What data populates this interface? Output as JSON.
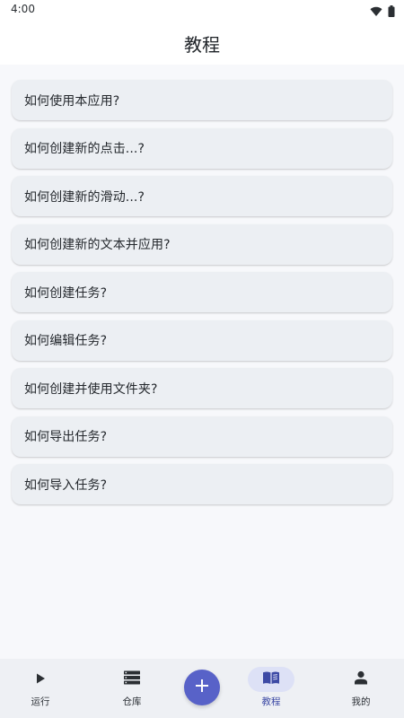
{
  "status_bar": {
    "time": "4:00",
    "icons": [
      "wifi-icon",
      "battery-icon"
    ]
  },
  "header": {
    "title": "教程"
  },
  "tutorials": [
    {
      "label": "如何使用本应用?"
    },
    {
      "label": "如何创建新的点击...?"
    },
    {
      "label": "如何创建新的滑动...?"
    },
    {
      "label": "如何创建新的文本并应用?"
    },
    {
      "label": "如何创建任务?"
    },
    {
      "label": "如何编辑任务?"
    },
    {
      "label": "如何创建并使用文件夹?"
    },
    {
      "label": "如何导出任务?"
    },
    {
      "label": "如何导入任务?"
    }
  ],
  "bottom_nav": {
    "items": [
      {
        "label": "运行",
        "icon": "play-icon"
      },
      {
        "label": "仓库",
        "icon": "storage-icon"
      },
      {
        "label": "教程",
        "icon": "book-icon",
        "active": true
      },
      {
        "label": "我的",
        "icon": "person-icon"
      }
    ],
    "fab_icon": "plus-icon"
  },
  "colors": {
    "accent": "#5862c8",
    "active_pill": "#dde1f6",
    "card": "#eceff3",
    "background": "#f7f8fb"
  }
}
